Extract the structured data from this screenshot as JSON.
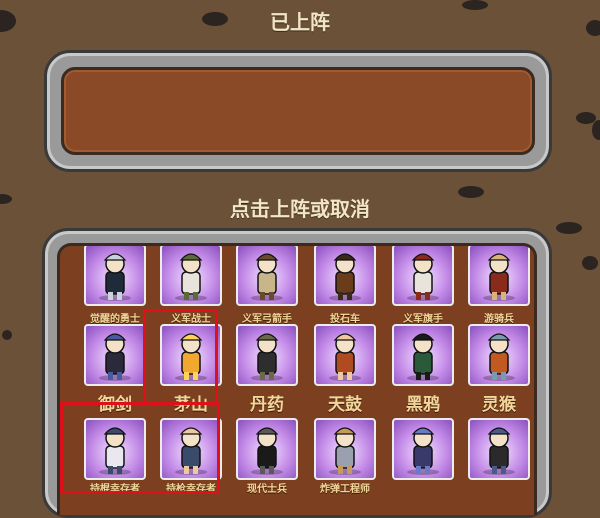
{
  "deployed_section": {
    "title": "已上阵"
  },
  "roster_section": {
    "title": "点击上阵或取消"
  },
  "roster": {
    "rows": [
      [
        {
          "name": "觉醒的勇士",
          "icon": "knight-icon"
        },
        {
          "name": "义军战士",
          "icon": "soldier-icon"
        },
        {
          "name": "义军弓箭手",
          "icon": "archer-icon"
        },
        {
          "name": "投石车",
          "icon": "catapult-icon"
        },
        {
          "name": "义军旗手",
          "icon": "flag-bearer-icon"
        },
        {
          "name": "游骑兵",
          "icon": "ranger-icon"
        }
      ],
      [
        {
          "name": "御剑",
          "icon": "sword-flyer-icon"
        },
        {
          "name": "茅山",
          "icon": "taoist-icon"
        },
        {
          "name": "丹药",
          "icon": "elixir-icon"
        },
        {
          "name": "天鼓",
          "icon": "drummer-icon"
        },
        {
          "name": "黑鸦",
          "icon": "crow-warrior-icon"
        },
        {
          "name": "灵猴",
          "icon": "monkey-icon"
        }
      ],
      [
        {
          "name": "持棍幸存者",
          "icon": "club-survivor-icon"
        },
        {
          "name": "持枪幸存者",
          "icon": "gun-survivor-icon"
        },
        {
          "name": "现代士兵",
          "icon": "modern-soldier-icon"
        },
        {
          "name": "炸弹工程师",
          "icon": "bomb-engineer-icon"
        },
        {
          "name": "",
          "icon": "drone-icon"
        },
        {
          "name": "",
          "icon": "cowboy-icon"
        }
      ]
    ]
  },
  "colors": {
    "background": "#6b5138",
    "highlight": "#e0101a",
    "label": "#f2d79a",
    "title": "#f3e6c7"
  }
}
